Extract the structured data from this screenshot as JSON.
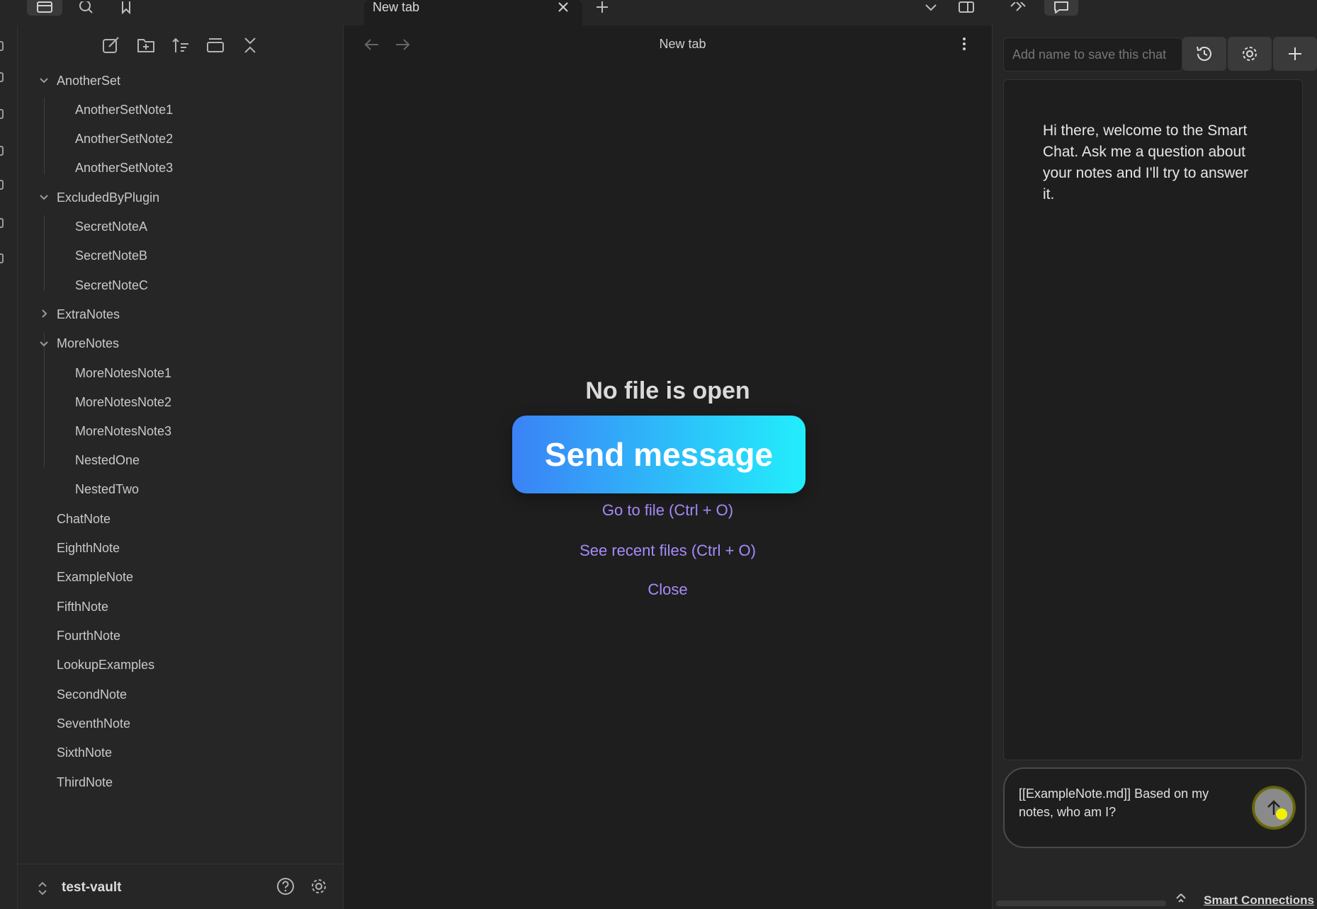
{
  "titlebar": {
    "tab_title": "New tab"
  },
  "sidebar": {
    "tree": [
      {
        "label": "AnotherSet",
        "level": 0,
        "expanded": true
      },
      {
        "label": "AnotherSetNote1",
        "level": 1
      },
      {
        "label": "AnotherSetNote2",
        "level": 1
      },
      {
        "label": "AnotherSetNote3",
        "level": 1
      },
      {
        "label": "ExcludedByPlugin",
        "level": 0,
        "expanded": true
      },
      {
        "label": "SecretNoteA",
        "level": 1
      },
      {
        "label": "SecretNoteB",
        "level": 1
      },
      {
        "label": "SecretNoteC",
        "level": 1
      },
      {
        "label": "ExtraNotes",
        "level": 0,
        "expanded": false
      },
      {
        "label": "MoreNotes",
        "level": 0,
        "expanded": true
      },
      {
        "label": "MoreNotesNote1",
        "level": 1
      },
      {
        "label": "MoreNotesNote2",
        "level": 1
      },
      {
        "label": "MoreNotesNote3",
        "level": 1
      },
      {
        "label": "NestedOne",
        "level": 1
      },
      {
        "label": "NestedTwo",
        "level": 1
      },
      {
        "label": "ChatNote",
        "level": 0
      },
      {
        "label": "EighthNote",
        "level": 0
      },
      {
        "label": "ExampleNote",
        "level": 0
      },
      {
        "label": "FifthNote",
        "level": 0
      },
      {
        "label": "FourthNote",
        "level": 0
      },
      {
        "label": "LookupExamples",
        "level": 0
      },
      {
        "label": "SecondNote",
        "level": 0
      },
      {
        "label": "SeventhNote",
        "level": 0
      },
      {
        "label": "SixthNote",
        "level": 0
      },
      {
        "label": "ThirdNote",
        "level": 0
      }
    ],
    "vault_name": "test-vault"
  },
  "main": {
    "nav_title": "New tab",
    "empty_title": "No file is open",
    "link_go_to_file": "Go to file (Ctrl + O)",
    "link_recent": "See recent files (Ctrl + O)",
    "link_close": "Close",
    "overlay_label": "Send message"
  },
  "chat": {
    "name_placeholder": "Add name to save this chat",
    "welcome_message": "Hi there, welcome to the Smart Chat. Ask me a question about your notes and I'll try to answer it.",
    "input_value": "[[ExampleNote.md]] Based on my notes, who am I?"
  },
  "statusbar": {
    "plugin_label": "Smart Connections"
  }
}
